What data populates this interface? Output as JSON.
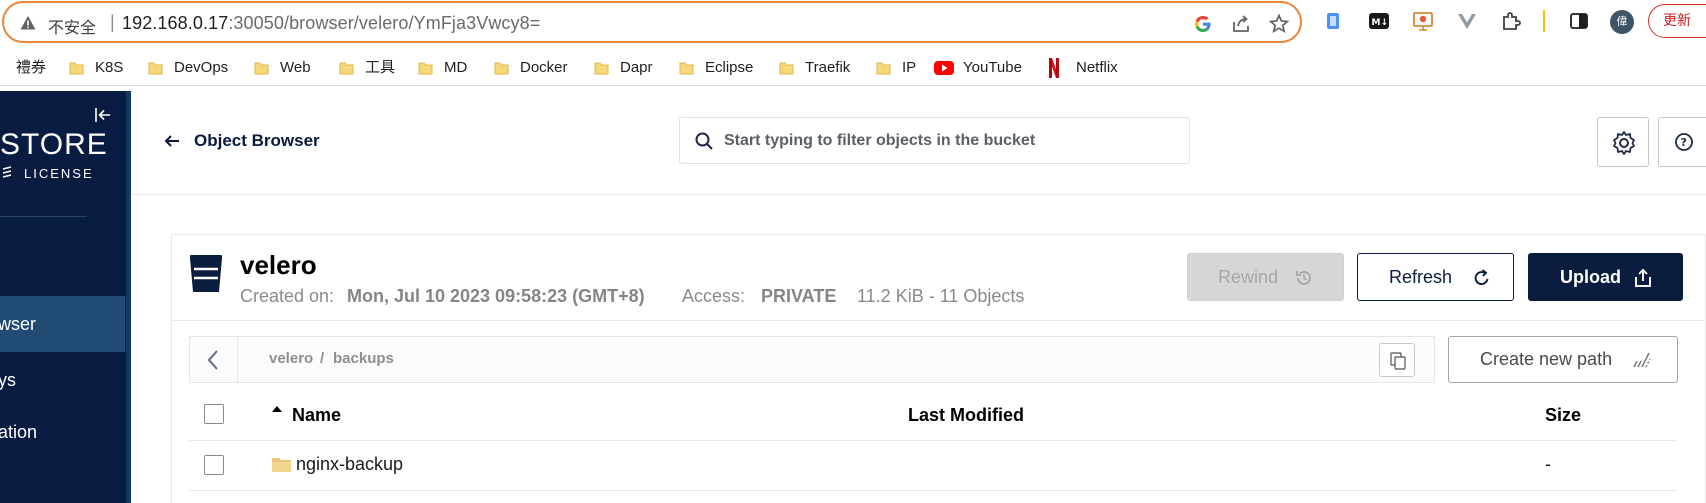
{
  "browser": {
    "insecure_label": "不安全",
    "separator": "|",
    "url_host": "192.168.0.17",
    "url_rest": ":30050/browser/velero/YmFja3Vwcy8=",
    "profile_initial": "偉",
    "update_label": "更新",
    "bookmarks": [
      {
        "label": "禮券",
        "icon": "folder-icon"
      },
      {
        "label": "K8S",
        "icon": "folder-icon"
      },
      {
        "label": "DevOps",
        "icon": "folder-icon"
      },
      {
        "label": "Web",
        "icon": "folder-icon"
      },
      {
        "label": "工具",
        "icon": "folder-icon"
      },
      {
        "label": "MD",
        "icon": "folder-icon"
      },
      {
        "label": "Docker",
        "icon": "folder-icon"
      },
      {
        "label": "Dapr",
        "icon": "folder-icon"
      },
      {
        "label": "Eclipse",
        "icon": "folder-icon"
      },
      {
        "label": "Traefik",
        "icon": "folder-icon"
      },
      {
        "label": "IP",
        "icon": "folder-icon"
      },
      {
        "label": "YouTube",
        "icon": "youtube-icon"
      },
      {
        "label": "Netflix",
        "icon": "netflix-icon"
      }
    ],
    "colors": {
      "omnibox_border": "#e8873a",
      "update_red": "#d93025"
    }
  },
  "sidebar": {
    "brand_text": "STORE",
    "brand_sub": "LICENSE",
    "items": [
      {
        "label": "wser",
        "active": true
      },
      {
        "label": "ys",
        "active": false
      },
      {
        "label": "ation",
        "active": false
      }
    ],
    "colors": {
      "background": "#081c42",
      "active": "#1f4b75"
    }
  },
  "header": {
    "back_label": "Object Browser",
    "search_placeholder": "Start typing to filter objects in the bucket",
    "search_value": ""
  },
  "bucket": {
    "name": "velero",
    "created_label": "Created on:",
    "created_value": "Mon, Jul 10 2023 09:58:23 (GMT+8)",
    "access_label": "Access:",
    "access_value": "PRIVATE",
    "usage": "11.2 KiB - 11 Objects"
  },
  "actions": {
    "rewind_label": "Rewind",
    "refresh_label": "Refresh",
    "upload_label": "Upload",
    "new_path_label": "Create new path"
  },
  "path": {
    "crumbs": [
      "velero",
      "/",
      "backups"
    ]
  },
  "table": {
    "columns": {
      "name": "Name",
      "last_modified": "Last Modified",
      "size": "Size"
    },
    "rows": [
      {
        "name": "nginx-backup",
        "last_modified": "",
        "size": "-"
      }
    ]
  }
}
